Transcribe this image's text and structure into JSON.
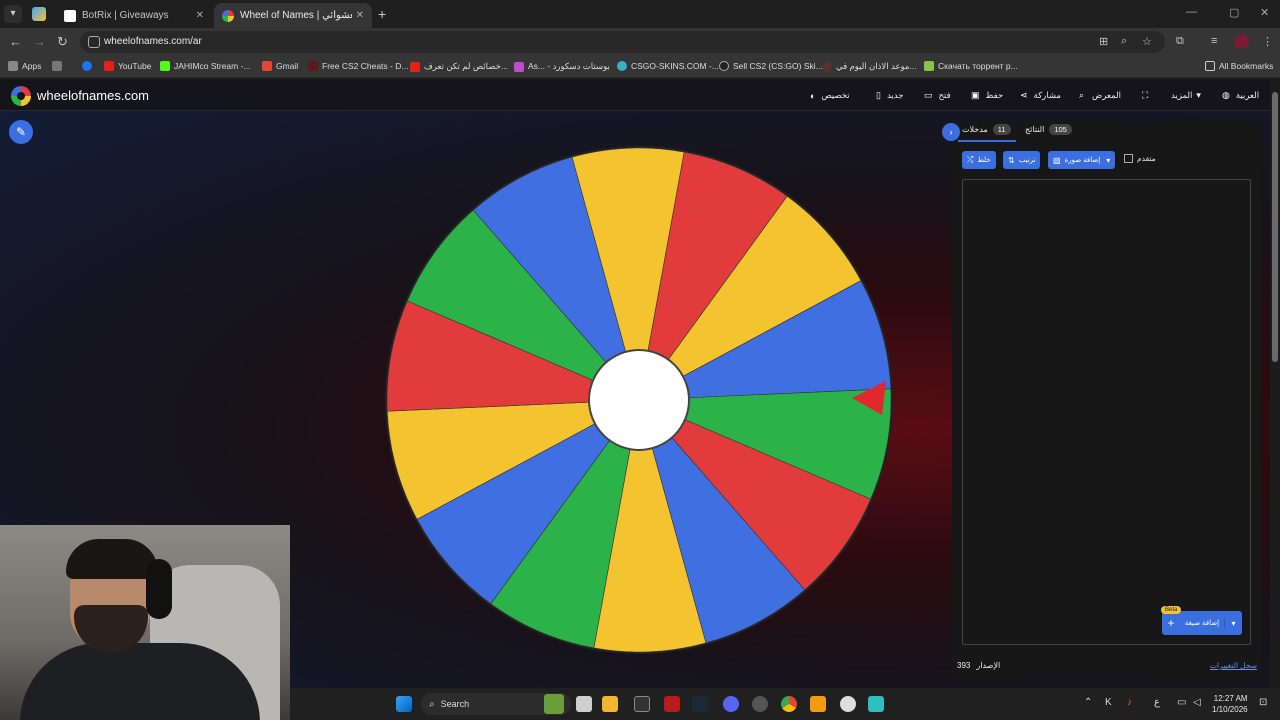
{
  "browser": {
    "tabs": [
      {
        "title": "BotRix | Giveaways",
        "active": false
      },
      {
        "title": "Wheel of Names | عجلة الأسماء العشوائي",
        "active": true
      }
    ],
    "url": "wheelofnames.com/ar",
    "bookmarks": [
      "Apps",
      "YouTube",
      "JAHIMco Stream -...",
      "Gmail",
      "Free CS2 Cheats - D...",
      "خصائص لم تكن تعرف...",
      "As... - بوستات دسكورد",
      "CSGO-SKINS.COM -...",
      "Sell CS2 (CS:GO) Ski...",
      "موعد الاذان اليوم في...",
      "Скачать торрент р...",
      "All Bookmarks"
    ]
  },
  "site": {
    "logo_text": "wheelofnames.com",
    "menu": {
      "customize": "تخصيص",
      "new": "جديد",
      "open": "فتح",
      "save": "حفظ",
      "share": "مشاركة",
      "gallery": "المعرض",
      "more": "المزيد",
      "language": "العربية"
    }
  },
  "wheel": {
    "slice_colors": [
      "#e23b3b",
      "#3f6fe0",
      "#f4c430",
      "#2bb34a"
    ],
    "slice_count": 14,
    "pointer_color": "#e0282e"
  },
  "panel": {
    "tab_entries_label": "مدخلات",
    "tab_entries_count": "11",
    "tab_results_label": "النتائج",
    "tab_results_count": "105",
    "shuffle_label": "خلط",
    "sort_label": "ترتيب",
    "add_image_label": "إضافة صورة",
    "advanced_label": "متقدم",
    "add_image_btn_label": "إضافة صيغة",
    "beta_label": "Beta",
    "version_label": "الإصدار",
    "version_number": "393",
    "changelog_label": "سجل التغييرات"
  },
  "taskbar": {
    "search_label": "Search",
    "time": "12:27 AM",
    "date": "1/10/2026",
    "lang_indicator": "ع"
  }
}
